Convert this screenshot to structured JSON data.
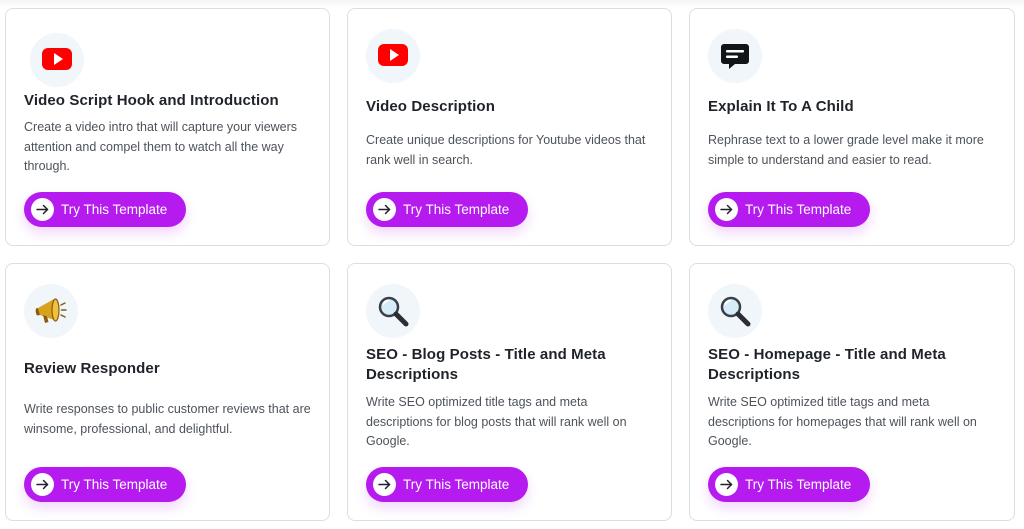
{
  "cards": [
    {
      "icon": "youtube-icon",
      "title": "Video Script Hook and Introduction",
      "description": "Create a video intro that will capture your viewers attention and compel them to watch all the way through.",
      "button_label": "Try This Template"
    },
    {
      "icon": "youtube-icon",
      "title": "Video Description",
      "description": "Create unique descriptions for Youtube videos that rank well in search.",
      "button_label": "Try This Template"
    },
    {
      "icon": "speech-bubble-icon",
      "title": "Explain It To A Child",
      "description": "Rephrase text to a lower grade level make it more simple to understand and easier to read.",
      "button_label": "Try This Template"
    },
    {
      "icon": "megaphone-icon",
      "title": "Review Responder",
      "description": "Write responses to public customer reviews that are winsome, professional, and delightful.",
      "button_label": "Try This Template"
    },
    {
      "icon": "magnifying-glass-icon",
      "title": "SEO - Blog Posts - Title and Meta Descriptions",
      "description": "Write SEO optimized title tags and meta descriptions for blog posts that will rank well on Google.",
      "button_label": "Try This Template"
    },
    {
      "icon": "magnifying-glass-icon",
      "title": "SEO - Homepage - Title and Meta Descriptions",
      "description": "Write SEO optimized title tags and meta descriptions for homepages that will rank well on Google.",
      "button_label": "Try This Template"
    }
  ],
  "colors": {
    "button": "#b51aee",
    "youtube": "#ff0000",
    "icon_bg": "#f1f6fb",
    "title": "#1f2329",
    "description": "#4d535b",
    "border": "#dcdee3"
  }
}
